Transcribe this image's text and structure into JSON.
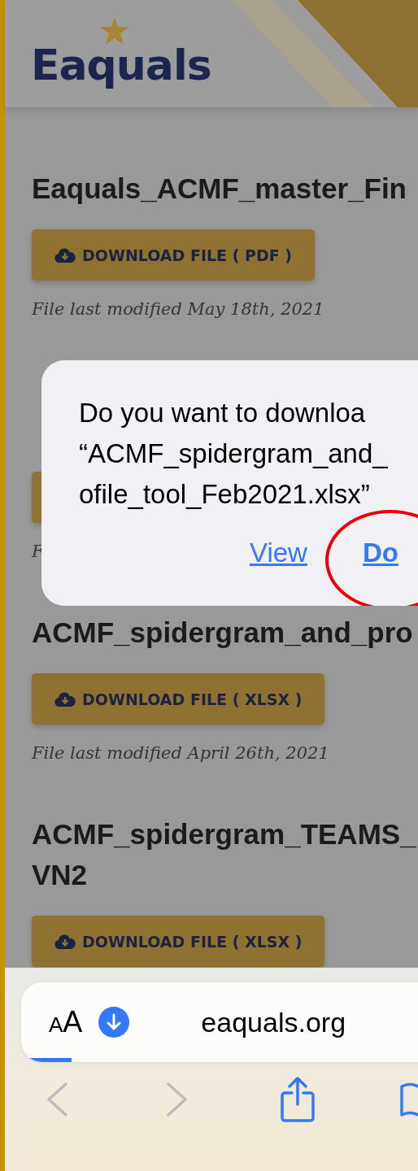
{
  "header": {
    "logo": "Eaquals"
  },
  "files": [
    {
      "title_lines": [
        "Eaquals_ACMF_master_Fin"
      ],
      "button": "DOWNLOAD FILE ( PDF )",
      "modified": "File last modified May 18th, 2021"
    },
    {
      "modified": "F"
    },
    {
      "title_lines": [
        "ACMF_spidergram_and_pro"
      ],
      "button": "DOWNLOAD FILE ( XLSX )",
      "modified": "File last modified April 26th, 2021"
    },
    {
      "title_lines": [
        "ACMF_spidergram_TEAMS_",
        "VN2"
      ],
      "button": "DOWNLOAD FILE ( XLSX )"
    }
  ],
  "dialog": {
    "message_lines": [
      "Do you want to downloa",
      "“ACMF_spidergram_and_",
      "ofile_tool_Feb2021.xlsx”"
    ],
    "buttons": [
      {
        "label": "View",
        "circled": false
      },
      {
        "label": "Do",
        "circled": true
      }
    ]
  },
  "browser": {
    "reader_button": "AA",
    "url": "eaquals.org",
    "level": 0.12,
    "toolbar": [
      {
        "kind": "back",
        "disabled": true
      },
      {
        "kind": "forward",
        "disabled": true
      },
      {
        "kind": "share",
        "disabled": false
      },
      {
        "kind": "bookmarks",
        "disabled": false
      }
    ]
  }
}
